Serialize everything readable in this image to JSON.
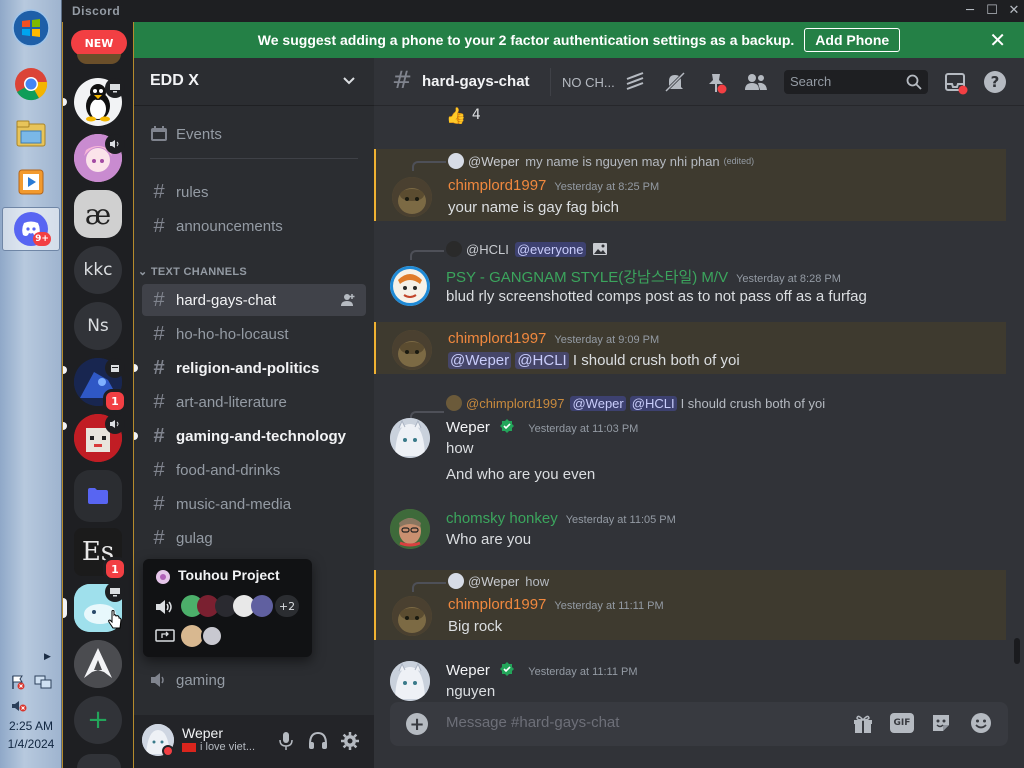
{
  "taskbar": {
    "time": "2:25 AM",
    "date": "1/4/2024",
    "discord_badge": "9+"
  },
  "titlebar": {
    "brand": "Discord",
    "minimize": "─",
    "maximize": "☐",
    "close": "✕"
  },
  "rail": {
    "new_label": "NEW",
    "servers": [
      {
        "name": "kkc"
      },
      {
        "name": "Ns"
      }
    ],
    "badges": [
      "1",
      "1",
      "1"
    ],
    "add_label": "+"
  },
  "banner": {
    "text": "We suggest adding a phone to your 2 factor authentication settings as a backup.",
    "button": "Add Phone",
    "close": "✕"
  },
  "guild": {
    "name": "EDD X",
    "chevron": "⌄",
    "events": "Events",
    "category": "TEXT CHANNELS",
    "channels": [
      {
        "name": "rules"
      },
      {
        "name": "announcements"
      },
      {
        "name": "hard-gays-chat"
      },
      {
        "name": "ho-ho-ho-locaust"
      },
      {
        "name": "religion-and-politics"
      },
      {
        "name": "art-and-literature"
      },
      {
        "name": "gaming-and-technology"
      },
      {
        "name": "food-and-drinks"
      },
      {
        "name": "music-and-media"
      },
      {
        "name": "gulag"
      }
    ],
    "voice_channel": "gaming"
  },
  "popout": {
    "title": "Touhou Project",
    "more": "+2"
  },
  "user": {
    "name": "Weper",
    "status": "i love viet..."
  },
  "chat": {
    "channel": "hard-gays-chat",
    "topic": "NO CH...",
    "search_placeholder": "Search",
    "reaction_count": "4",
    "messages": [
      {
        "reply_user": "@Weper",
        "reply_text": "my name is nguyen may nhi phan",
        "reply_edited": "(edited)",
        "author": "chimplord1997",
        "time": "Yesterday at 8:25 PM",
        "text": "your name is gay fag bich"
      },
      {
        "reply_user": "@HCLI",
        "reply_mention": "@everyone",
        "author": "PSY - GANGNAM STYLE(강남스타일) M/V",
        "time": "Yesterday at 8:28 PM",
        "text": "blud rly screenshotted comps post as to not pass off as a furfag"
      },
      {
        "author": "chimplord1997",
        "time": "Yesterday at 9:09 PM",
        "mention1": "@Weper",
        "mention2": "@HCLI",
        "text": "I should crush both of yoi"
      },
      {
        "reply_user": "@chimplord1997",
        "reply_m1": "@Weper",
        "reply_m2": "@HCLI",
        "reply_text": "I should crush both of yoi",
        "author": "Weper",
        "time": "Yesterday at 11:03 PM",
        "text1": "how",
        "text2": "And who are you even"
      },
      {
        "author": "chomsky honkey",
        "time": "Yesterday at 11:05 PM",
        "text": "Who are you"
      },
      {
        "reply_user": "@Weper",
        "reply_text": "how",
        "author": "chimplord1997",
        "time": "Yesterday at 11:11 PM",
        "text": "Big rock"
      },
      {
        "author": "Weper",
        "time": "Yesterday at 11:11 PM",
        "text": "nguyen"
      }
    ],
    "composer_placeholder": "Message #hard-gays-chat",
    "gif_label": "GIF"
  }
}
